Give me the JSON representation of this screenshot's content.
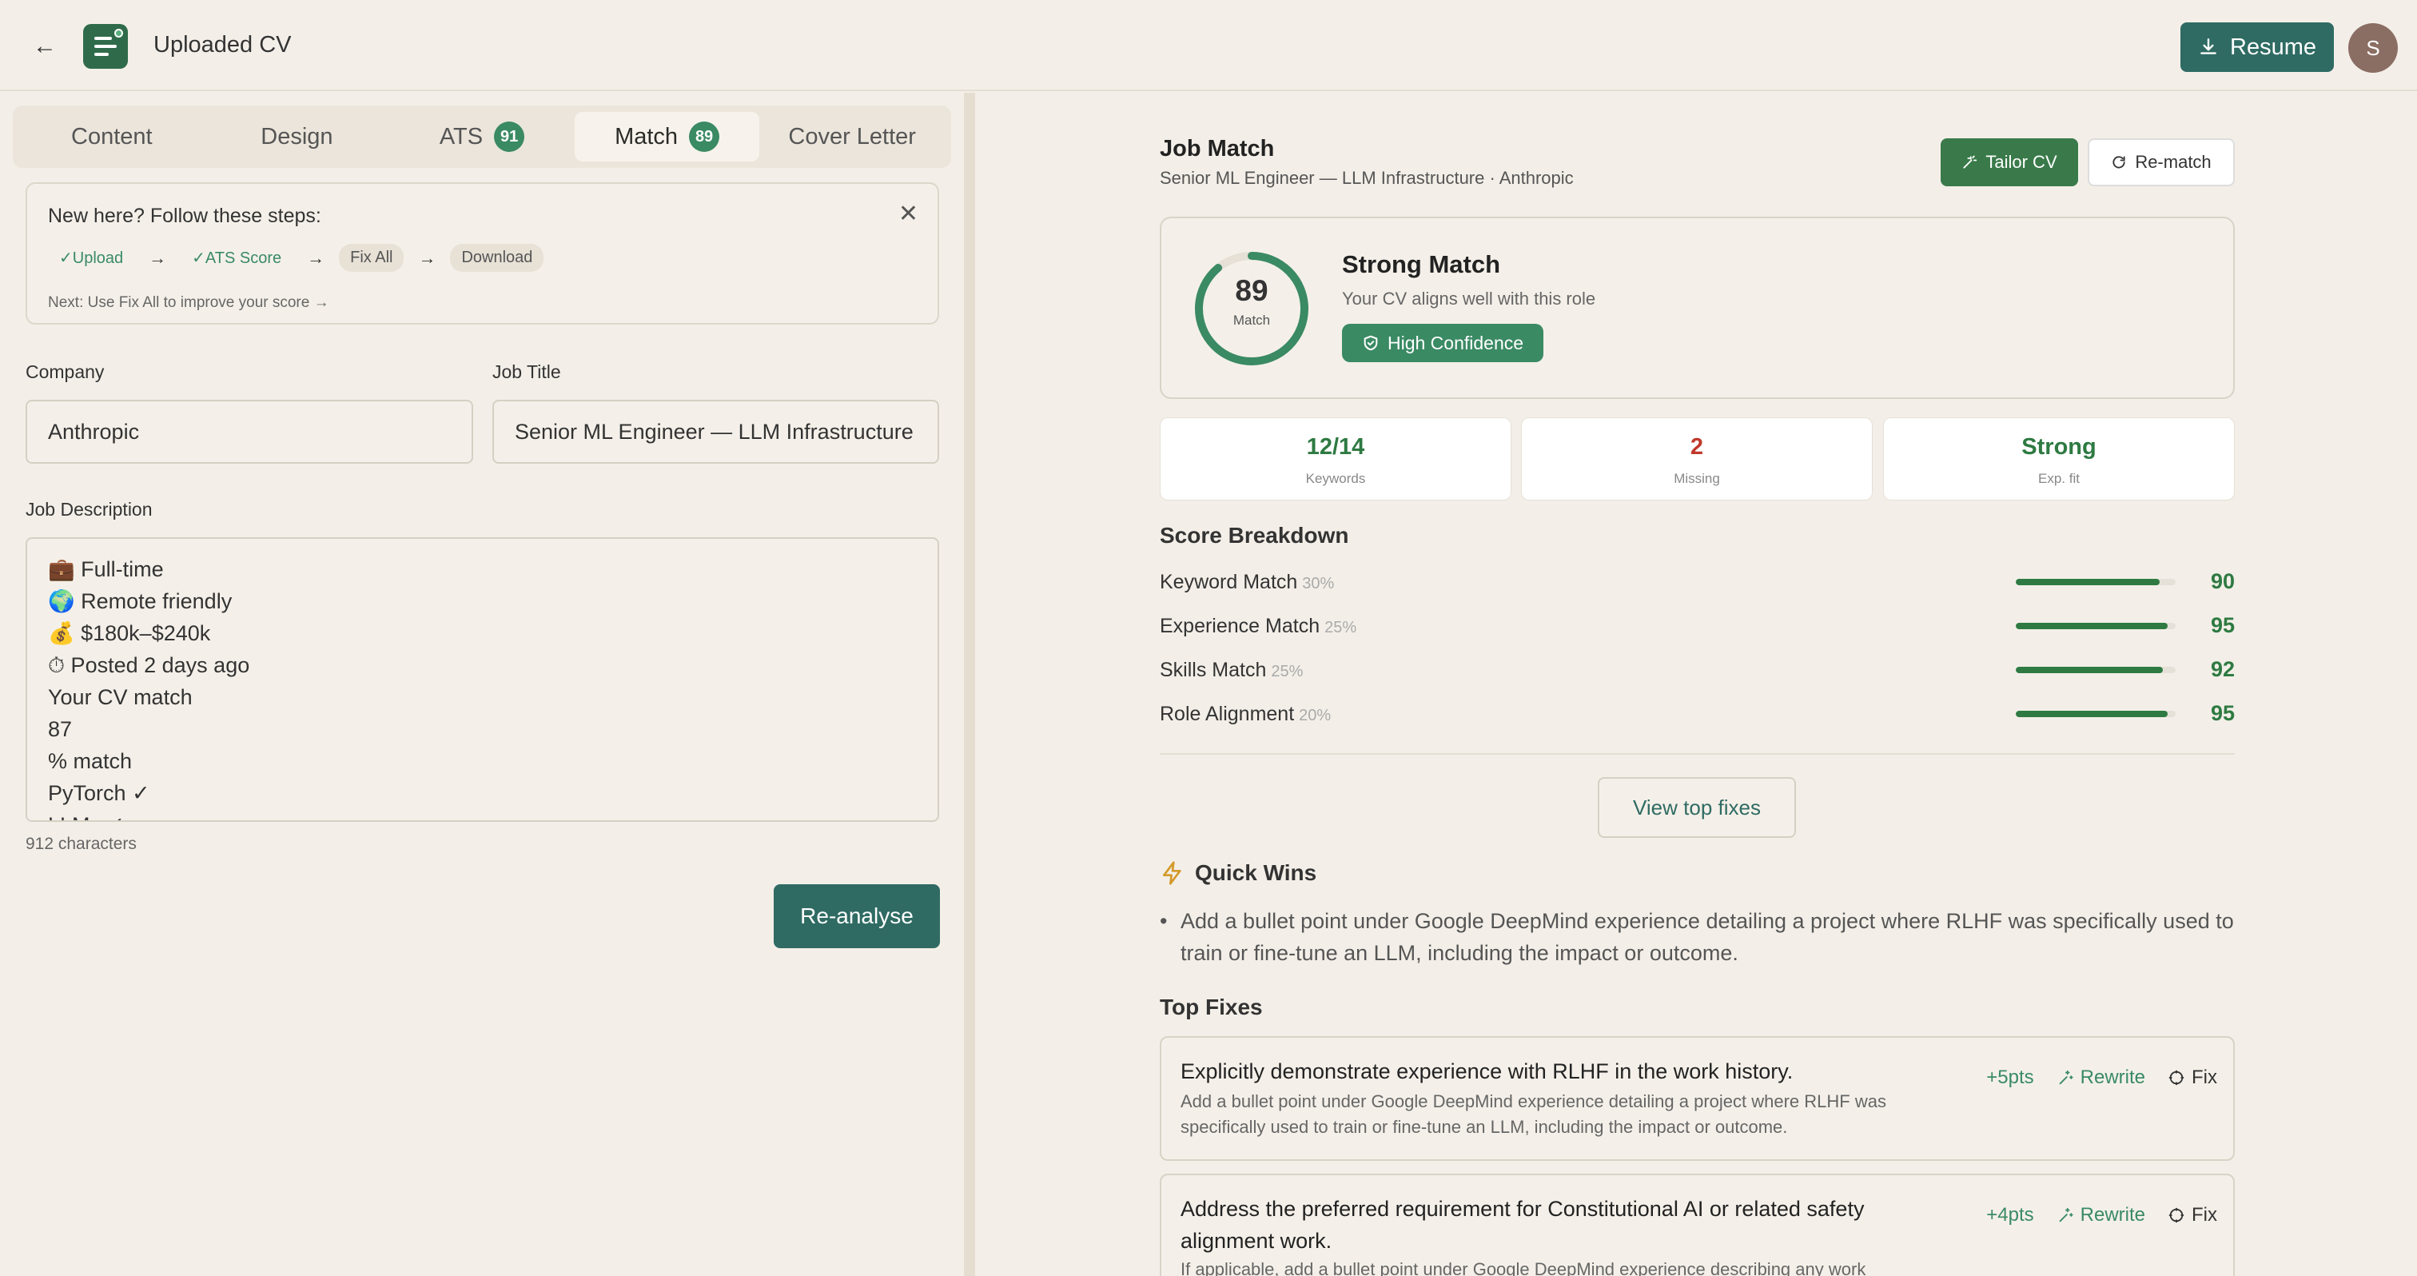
{
  "header": {
    "title": "Uploaded CV",
    "resume_label": "Resume",
    "avatar_initial": "S"
  },
  "tabs": [
    {
      "label": "Content",
      "badge": ""
    },
    {
      "label": "Design",
      "badge": ""
    },
    {
      "label": "ATS",
      "badge": "91"
    },
    {
      "label": "Match",
      "badge": "89",
      "active": true
    },
    {
      "label": "Cover Letter",
      "badge": ""
    }
  ],
  "steps": {
    "title": "New here? Follow these steps:",
    "items": [
      "✓Upload",
      "✓ATS Score",
      "Fix All",
      "Download"
    ],
    "next": "Next: Use Fix All to improve your score →"
  },
  "form": {
    "company_label": "Company",
    "company_value": "Anthropic",
    "jobtitle_label": "Job Title",
    "jobtitle_value": "Senior ML Engineer — LLM Infrastructure",
    "desc_label": "Job Description",
    "desc_lines": [
      "💼 Full-time",
      "🌍 Remote friendly",
      "💰 $180k–$240k",
      "⏱ Posted 2 days ago",
      "Your CV match",
      "87",
      "% match",
      "PyTorch ✓",
      "LLMs ✓"
    ],
    "char_count": "912 characters",
    "reanalyse_label": "Re-analyse"
  },
  "match": {
    "title": "Job Match",
    "subtitle": "Senior ML Engineer — LLM Infrastructure · Anthropic",
    "tailor_label": "Tailor CV",
    "rematch_label": "Re-match",
    "score": 89,
    "score_label": "Match",
    "verdict": "Strong Match",
    "verdict_sub": "Your CV aligns well with this role",
    "confidence": "High Confidence",
    "stats": [
      {
        "value": "12/14",
        "label": "Keywords",
        "color": "#2e7a42"
      },
      {
        "value": "2",
        "label": "Missing",
        "color": "#c0392b"
      },
      {
        "value": "Strong",
        "label": "Exp. fit",
        "color": "#2e7a42"
      }
    ],
    "breakdown_title": "Score Breakdown",
    "breakdown": [
      {
        "name": "Keyword Match",
        "weight": "30%",
        "value": 90
      },
      {
        "name": "Experience Match",
        "weight": "25%",
        "value": 95
      },
      {
        "name": "Skills Match",
        "weight": "25%",
        "value": 92
      },
      {
        "name": "Role Alignment",
        "weight": "20%",
        "value": 95
      }
    ],
    "view_fixes_label": "View top fixes",
    "quick_wins_title": "Quick Wins",
    "quick_wins": [
      "Add a bullet point under Google DeepMind experience detailing a project where RLHF was specifically used to train or fine-tune an LLM, including the impact or outcome."
    ],
    "top_fixes_title": "Top Fixes",
    "fixes": [
      {
        "title": "Explicitly demonstrate experience with RLHF in the work history.",
        "desc": "Add a bullet point under Google DeepMind experience detailing a project where RLHF was specifically used to train or fine-tune an LLM, including the impact or outcome.",
        "pts": "+5pts"
      },
      {
        "title": "Address the preferred requirement for Constitutional AI or related safety alignment work.",
        "desc": "If applicable, add a bullet point under Google DeepMind experience describing any work",
        "pts": "+4pts"
      }
    ],
    "rewrite_label": "Rewrite",
    "fix_label": "Fix"
  }
}
